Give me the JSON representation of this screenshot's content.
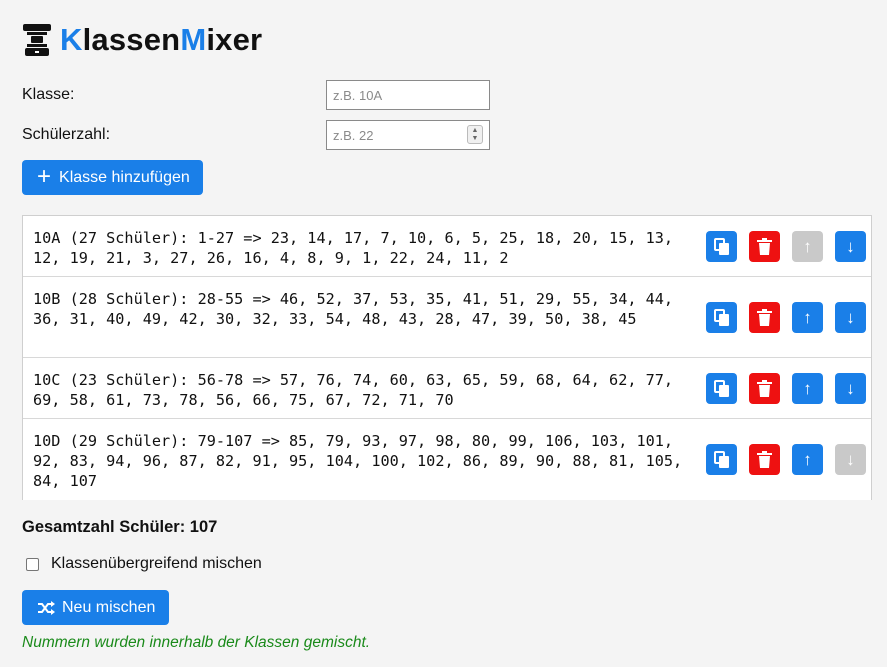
{
  "header": {
    "title_part1": "K",
    "title_part2": "lassen",
    "title_part3": "M",
    "title_part4": "ixer",
    "logo_icon": "printer-stack-icon"
  },
  "form": {
    "class_label": "Klasse:",
    "class_placeholder": "z.B. 10A",
    "count_label": "Schülerzahl:",
    "count_placeholder": "z.B. 22",
    "add_button": "Klasse hinzufügen"
  },
  "classes": [
    {
      "text": "10A (27 Schüler): 1-27 => 23, 14, 17, 7, 10, 6, 5, 25, 18, 20, 15, 13, 12, 19, 21, 3, 27, 26, 16, 4, 8, 9, 1, 22, 24, 11, 2",
      "up_disabled": true,
      "down_disabled": false
    },
    {
      "text": "10B (28 Schüler): 28-55 => 46, 52, 37, 53, 35, 41, 51, 29, 55, 34, 44, 36, 31, 40, 49, 42, 30, 32, 33, 54, 48, 43, 28, 47, 39, 50, 38, 45",
      "up_disabled": false,
      "down_disabled": false
    },
    {
      "text": "10C (23 Schüler): 56-78 => 57, 76, 74, 60, 63, 65, 59, 68, 64, 62, 77, 69, 58, 61, 73, 78, 56, 66, 75, 67, 72, 71, 70",
      "up_disabled": false,
      "down_disabled": false
    },
    {
      "text": "10D (29 Schüler): 79-107 => 85, 79, 93, 97, 98, 80, 99, 106, 103, 101, 92, 83, 94, 96, 87, 82, 91, 95, 104, 100, 102, 86, 89, 90, 88, 81, 105, 84, 107",
      "up_disabled": false,
      "down_disabled": true
    }
  ],
  "actions": {
    "up_glyph": "↑",
    "down_glyph": "↓"
  },
  "total": "Gesamtzahl Schüler: 107",
  "cross_mix_label": "Klassenübergreifend mischen",
  "cross_mix_checked": false,
  "mix_button": "Neu mischen",
  "status": "Nummern wurden innerhalb der Klassen gemischt.",
  "colors": {
    "accent": "#1a7fe8",
    "danger": "#ee1111",
    "disabled": "#c9c9c9",
    "success": "#1a8a1a"
  }
}
